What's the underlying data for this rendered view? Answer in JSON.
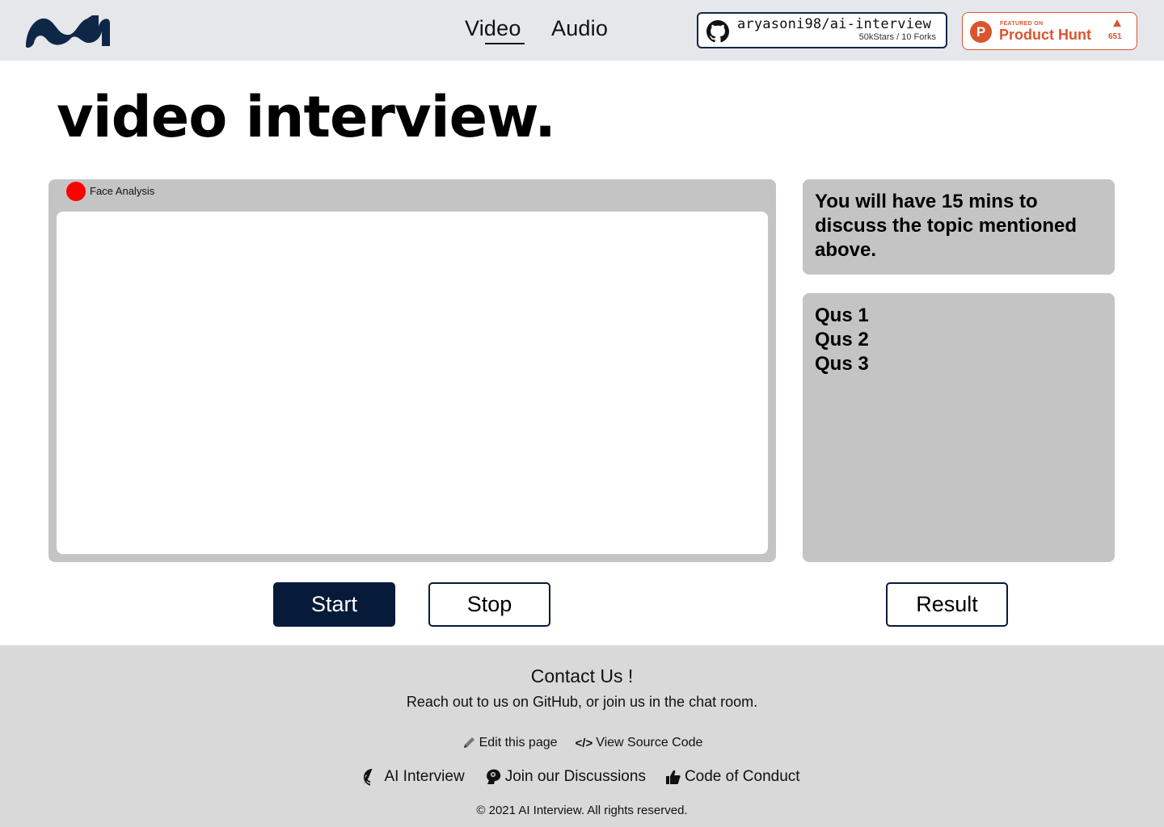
{
  "header": {
    "nav": {
      "video": "Video",
      "audio": "Audio"
    },
    "github_badge": {
      "repo": "aryasoni98/ai-interview",
      "stats": "50kStars / 10 Forks"
    },
    "producthunt_badge": {
      "featured": "FEATURED ON",
      "name": "Product Hunt",
      "count": "651"
    }
  },
  "main": {
    "title": "video interview.",
    "video_panel": {
      "label": "Face Analysis"
    },
    "info": "You will have 15 mins to discuss the topic mentioned above.",
    "questions": [
      "Qus 1",
      "Qus 2",
      "Qus 3"
    ],
    "buttons": {
      "start": "Start",
      "stop": "Stop",
      "result": "Result"
    }
  },
  "footer": {
    "title": "Contact Us !",
    "subtitle": "Reach out to us on GitHub, or join us in the chat room.",
    "links_row1": {
      "edit": "Edit this page",
      "source": "View Source Code"
    },
    "links_row2": {
      "ai": "AI Interview",
      "discuss": "Join our Discussions",
      "conduct": "Code of Conduct"
    },
    "copyright": "© 2021 AI Interview. All rights reserved."
  },
  "colors": {
    "header_bg": "#e5e7eb",
    "primary": "#061a3a",
    "panel": "#c4c4c4",
    "recording": "#ff0000",
    "producthunt": "#da552f",
    "footer_bg": "#d9d9d9"
  },
  "icons": [
    "logo-icon",
    "github-icon",
    "producthunt-icon",
    "upvote-arrow-icon",
    "pencil-icon",
    "code-icon",
    "discussion-icon",
    "thumbs-up-icon"
  ]
}
